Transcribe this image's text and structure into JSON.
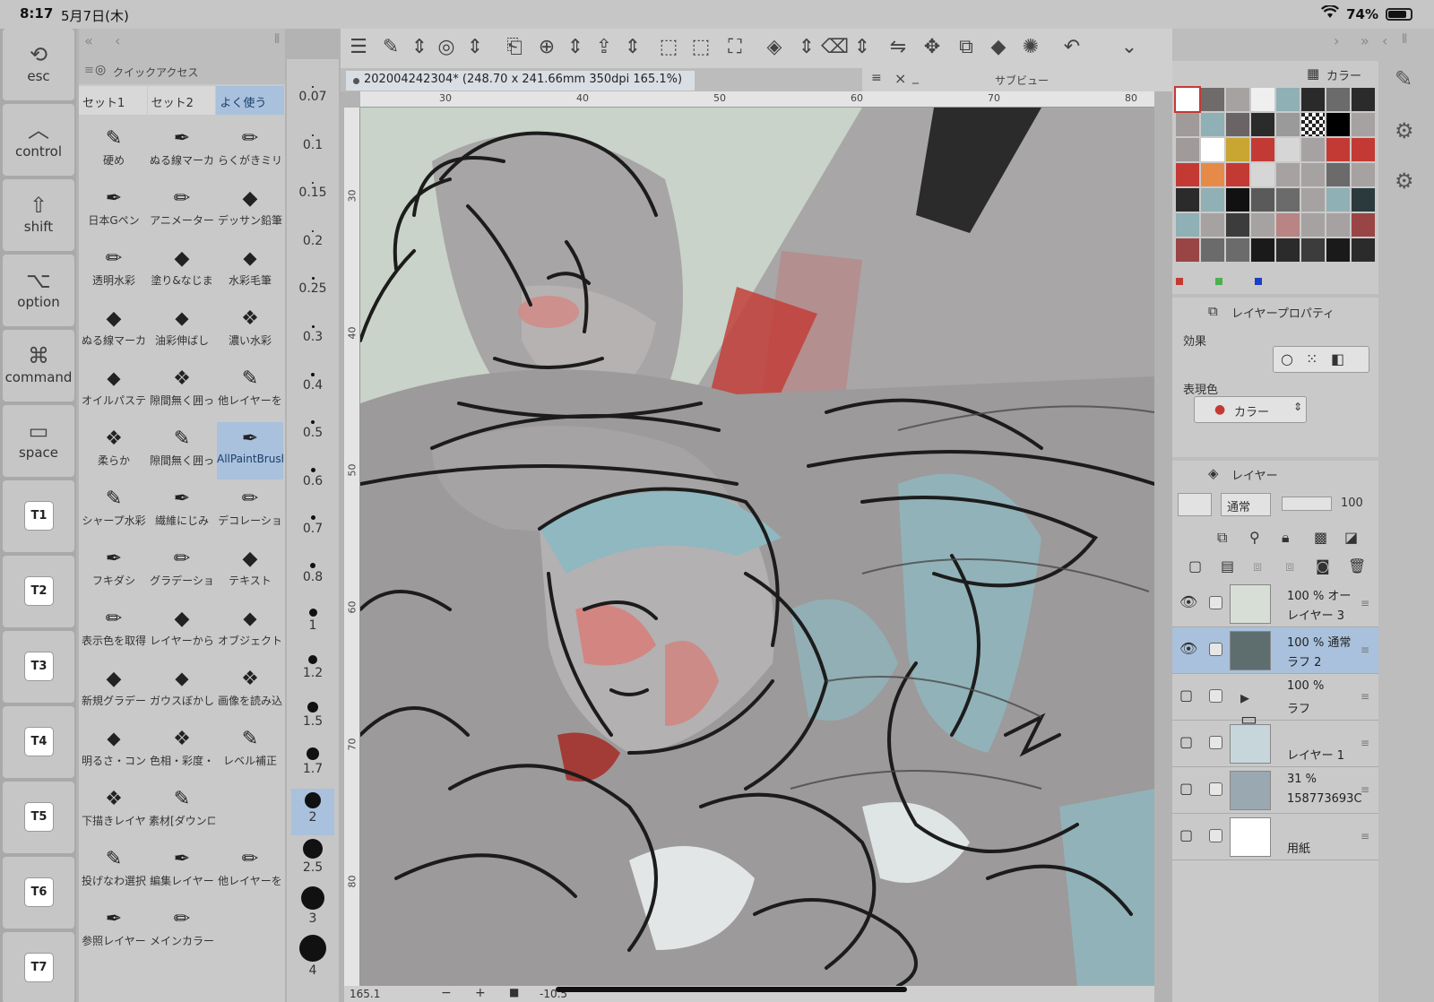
{
  "status": {
    "time": "8:17",
    "date": "5月7日(木)",
    "battery": "74%",
    "wifi_icon": "wifi-icon"
  },
  "keys": [
    {
      "label": "esc",
      "icon": "esc-icon",
      "sym": "⟲"
    },
    {
      "label": "control",
      "icon": "control-icon",
      "sym": "︿"
    },
    {
      "label": "shift",
      "icon": "shift-icon",
      "sym": "⇧"
    },
    {
      "label": "option",
      "icon": "option-icon",
      "sym": "⌥"
    },
    {
      "label": "command",
      "icon": "command-icon",
      "sym": "⌘"
    },
    {
      "label": "space",
      "icon": "space-icon",
      "sym": "▭"
    }
  ],
  "tkeys": [
    "T1",
    "T2",
    "T3",
    "T4",
    "T5",
    "T6",
    "T7"
  ],
  "quick_access": {
    "title": "クイックアクセス",
    "tabs": [
      "セット1",
      "セット2",
      "よく使う"
    ],
    "active_tab": 2,
    "tools": [
      [
        "硬め",
        "ぬる線マーカ",
        "らくがきミリ"
      ],
      [
        "日本Gペン",
        "アニメーター",
        "デッサン鉛筆"
      ],
      [
        "透明水彩",
        "塗り&なじま",
        "水彩毛筆"
      ],
      [
        "ぬる線マーカ",
        "油彩伸ばし",
        "濃い水彩"
      ],
      [
        "オイルパステ",
        "隙間無く囲っ",
        "他レイヤーを"
      ],
      [
        "柔らか",
        "隙間無く囲っ",
        "AllPaintBrush"
      ],
      [
        "シャープ水彩",
        "繊維にじみ",
        "デコレーショ"
      ],
      [
        "フキダシ",
        "グラデーショ",
        "テキスト"
      ],
      [
        "表示色を取得",
        "レイヤーから",
        "オブジェクト"
      ],
      [
        "新規グラデー",
        "ガウスぼかし",
        "画像を読み込"
      ],
      [
        "明るさ・コン",
        "色相・彩度・",
        "レベル補正"
      ],
      [
        "下描きレイヤ",
        "素材[ダウンロ",
        ""
      ],
      [
        "投げなわ選択",
        "編集レイヤー",
        "他レイヤーを"
      ],
      [
        "参照レイヤー",
        "メインカラー",
        ""
      ]
    ],
    "selected_tool": "AllPaintBrush"
  },
  "brush_sizes": [
    "0.07",
    "0.1",
    "0.15",
    "0.2",
    "0.25",
    "0.3",
    "0.4",
    "0.5",
    "0.6",
    "0.7",
    "0.8",
    "1",
    "1.2",
    "1.5",
    "1.7",
    "2",
    "2.5",
    "3",
    "4"
  ],
  "selected_size": "2",
  "document": {
    "title": "202004242304* (248.70 x 241.66mm 350dpi 165.1%)"
  },
  "subview": {
    "title": "サブビュー"
  },
  "ruler_h": [
    "30",
    "40",
    "50",
    "60",
    "70",
    "80"
  ],
  "ruler_v": [
    "30",
    "40",
    "50",
    "60",
    "70",
    "80"
  ],
  "bottom": {
    "zoom": "165.1",
    "rotation": "-10.5"
  },
  "color_panel": {
    "title": "カラー"
  },
  "swatch_colors": [
    "#ffffff",
    "#6f6b6b",
    "#a7a2a2",
    "#efefef",
    "#8fb0b5",
    "#2a2a2a",
    "#6b6b6b",
    "#2b2b2b",
    "#a09a9b",
    "#8fb0b5",
    "#6a6466",
    "#2b2b2b",
    "#9a9a9a",
    "#checker",
    "#000000",
    "#a7a2a2",
    "#a09a9b",
    "#ffffff",
    "#c9a532",
    "#c33a34",
    "#d6d6d6",
    "#a7a2a2",
    "#c33a34",
    "#c33a34",
    "#c33a34",
    "#e68a4a",
    "#c33a34",
    "#d6d6d6",
    "#a7a2a2",
    "#a7a2a2",
    "#6b6b6b",
    "#a7a2a2",
    "#2b2b2b",
    "#8fb0b5",
    "#111111",
    "#5a5a5a",
    "#6b6b6b",
    "#a7a2a2",
    "#8fb0b5",
    "#2b3a3d",
    "#8fb0b5",
    "#a7a2a2",
    "#3c3c3c",
    "#a7a2a2",
    "#b98484",
    "#a7a2a2",
    "#a7a2a2",
    "#9a4545",
    "#9a4545",
    "#6b6b6b",
    "#6b6b6b",
    "#1a1a1a",
    "#2b2b2b",
    "#3c3c3c",
    "#1a1a1a",
    "#2b2b2b"
  ],
  "layer_props": {
    "title": "レイヤープロパティ",
    "effect_label": "効果",
    "color_label": "表現色",
    "color_value": "カラー"
  },
  "layers_panel": {
    "title": "レイヤー",
    "blend": "通常",
    "opacity": "100"
  },
  "layers": [
    {
      "pct": "100 % オー",
      "name": "レイヤー 3",
      "visible": true,
      "thumb": "#d6ded6",
      "selected": false
    },
    {
      "pct": "100 % 通常",
      "name": "ラフ 2",
      "visible": true,
      "thumb": "#5e6e6e",
      "selected": true
    },
    {
      "pct": "100 %",
      "name": "ラフ",
      "visible": false,
      "thumb": "folder",
      "selected": false
    },
    {
      "pct": "",
      "name": "レイヤー 1",
      "visible": false,
      "thumb": "#c7d6da",
      "selected": false
    },
    {
      "pct": "31 %",
      "name": "158773693C",
      "visible": false,
      "thumb": "#9aa8b2",
      "selected": false
    },
    {
      "pct": "",
      "name": "用紙",
      "visible": false,
      "thumb": "#ffffff",
      "selected": false
    }
  ]
}
